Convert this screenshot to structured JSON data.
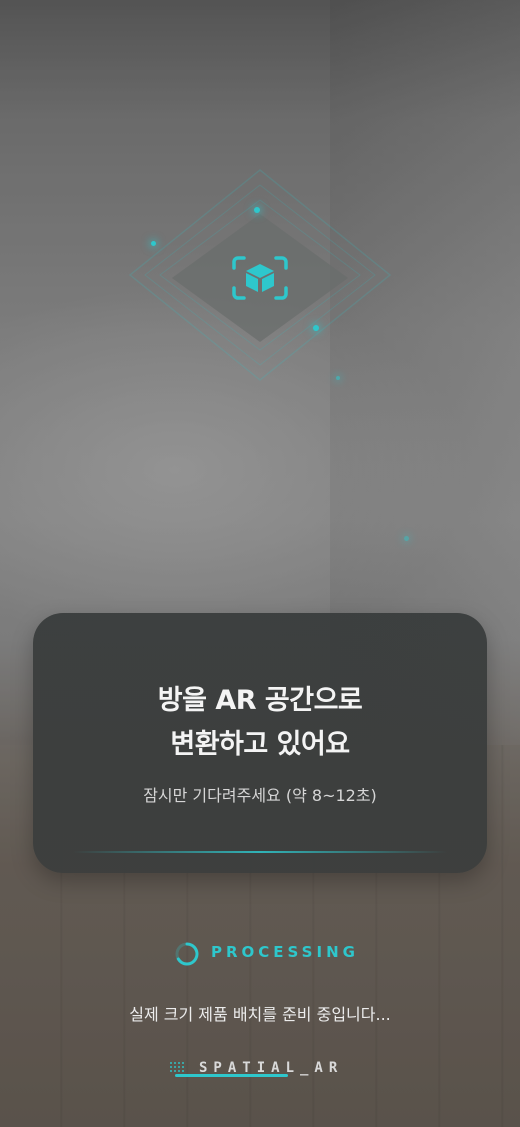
{
  "modal": {
    "title_line1": "방을 AR 공간으로",
    "title_line2": "변환하고 있어요",
    "subtitle": "잠시만 기다려주세요 (약 8~12초)"
  },
  "status": {
    "processing_label": "PROCESSING",
    "message": "실제 크기 제품 배치를 준비 중입니다..."
  },
  "brand": {
    "name": "SPATIAL_AR"
  },
  "icons": {
    "ar_cube": "ar-cube-icon",
    "spinner": "spinner-icon",
    "brand_grid": "grid-icon"
  },
  "colors": {
    "accent": "#2ec7cc",
    "card_bg": "#3b3e3d"
  }
}
